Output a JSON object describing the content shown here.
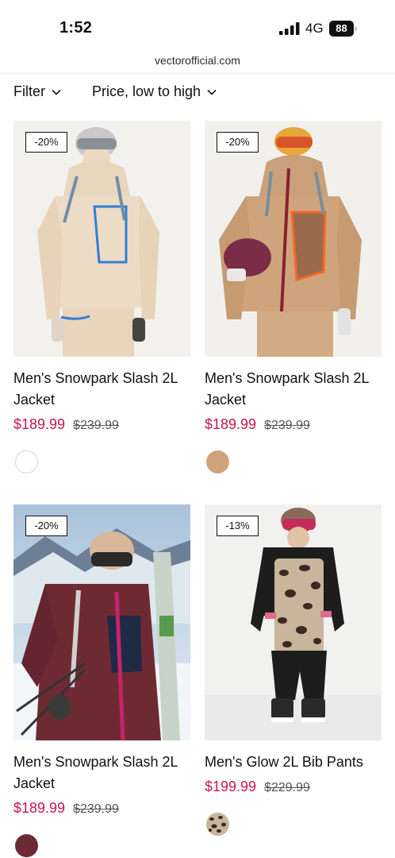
{
  "status_bar": {
    "time": "1:52",
    "network": "4G",
    "battery": "88",
    "signal_icon": "signal-bars-icon"
  },
  "browser": {
    "url": "vectorofficial.com"
  },
  "toolbar": {
    "filter_label": "Filter",
    "sort_label": "Price, low to high"
  },
  "products": [
    {
      "badge": "-20%",
      "title": "Men's Snowpark Slash 2L Jacket",
      "sale_price": "$189.99",
      "original_price": "$239.99",
      "swatch_color": "#ffffff"
    },
    {
      "badge": "-20%",
      "title": "Men's Snowpark Slash 2L Jacket",
      "sale_price": "$189.99",
      "original_price": "$239.99",
      "swatch_color": "#cfa47c"
    },
    {
      "badge": "-20%",
      "title": "Men's Snowpark Slash 2L Jacket",
      "sale_price": "$189.99",
      "original_price": "$239.99",
      "swatch_color": "#6e2a33"
    },
    {
      "badge": "-13%",
      "title": "Men's Glow 2L Bib Pants",
      "sale_price": "$199.99",
      "original_price": "$229.99",
      "swatch_color": "leopard"
    }
  ]
}
